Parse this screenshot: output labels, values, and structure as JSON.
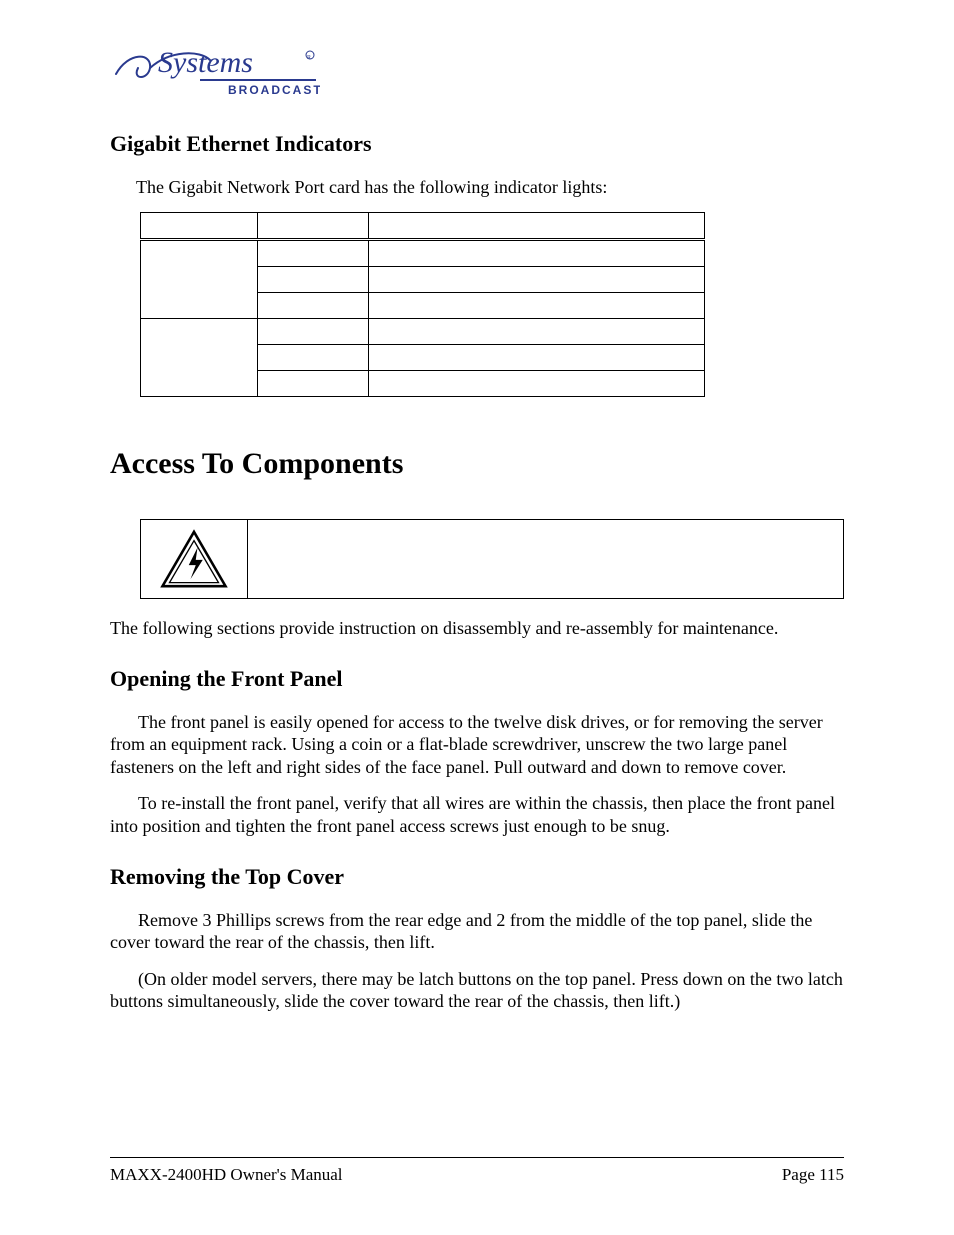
{
  "logo": {
    "script_text": "360 Systems",
    "sub_text": "BROADCAST"
  },
  "section1": {
    "heading": "Gigabit Ethernet Indicators",
    "intro": "The Gigabit Network Port card has the following indicator lights:"
  },
  "main_heading": "Access To Components",
  "disassembly_intro": "The following sections provide instruction on disassembly and re-assembly for maintenance.",
  "section2": {
    "heading": "Opening the Front Panel",
    "p1": "The front panel is easily opened for access to the twelve disk drives, or for removing the server from an equipment rack.  Using a coin or a flat-blade screwdriver, unscrew the two large panel fasteners on the left and right sides of the face panel. Pull outward and down to remove cover.",
    "p2": "To re-install the front panel, verify that all wires are within the chassis, then place the front panel into position and tighten the front panel access screws just enough to be snug."
  },
  "section3": {
    "heading": "Removing the Top Cover",
    "p1": "Remove 3 Phillips screws from the rear edge and 2 from the middle of the top panel, slide the cover toward the rear of the chassis, then lift.",
    "p2": "(On older model servers, there may be latch buttons on the top panel. Press down on the two latch buttons simultaneously, slide the cover toward the rear of the chassis, then lift.)"
  },
  "footer": {
    "left": "MAXX-2400HD Owner's Manual",
    "right": "Page 115"
  }
}
